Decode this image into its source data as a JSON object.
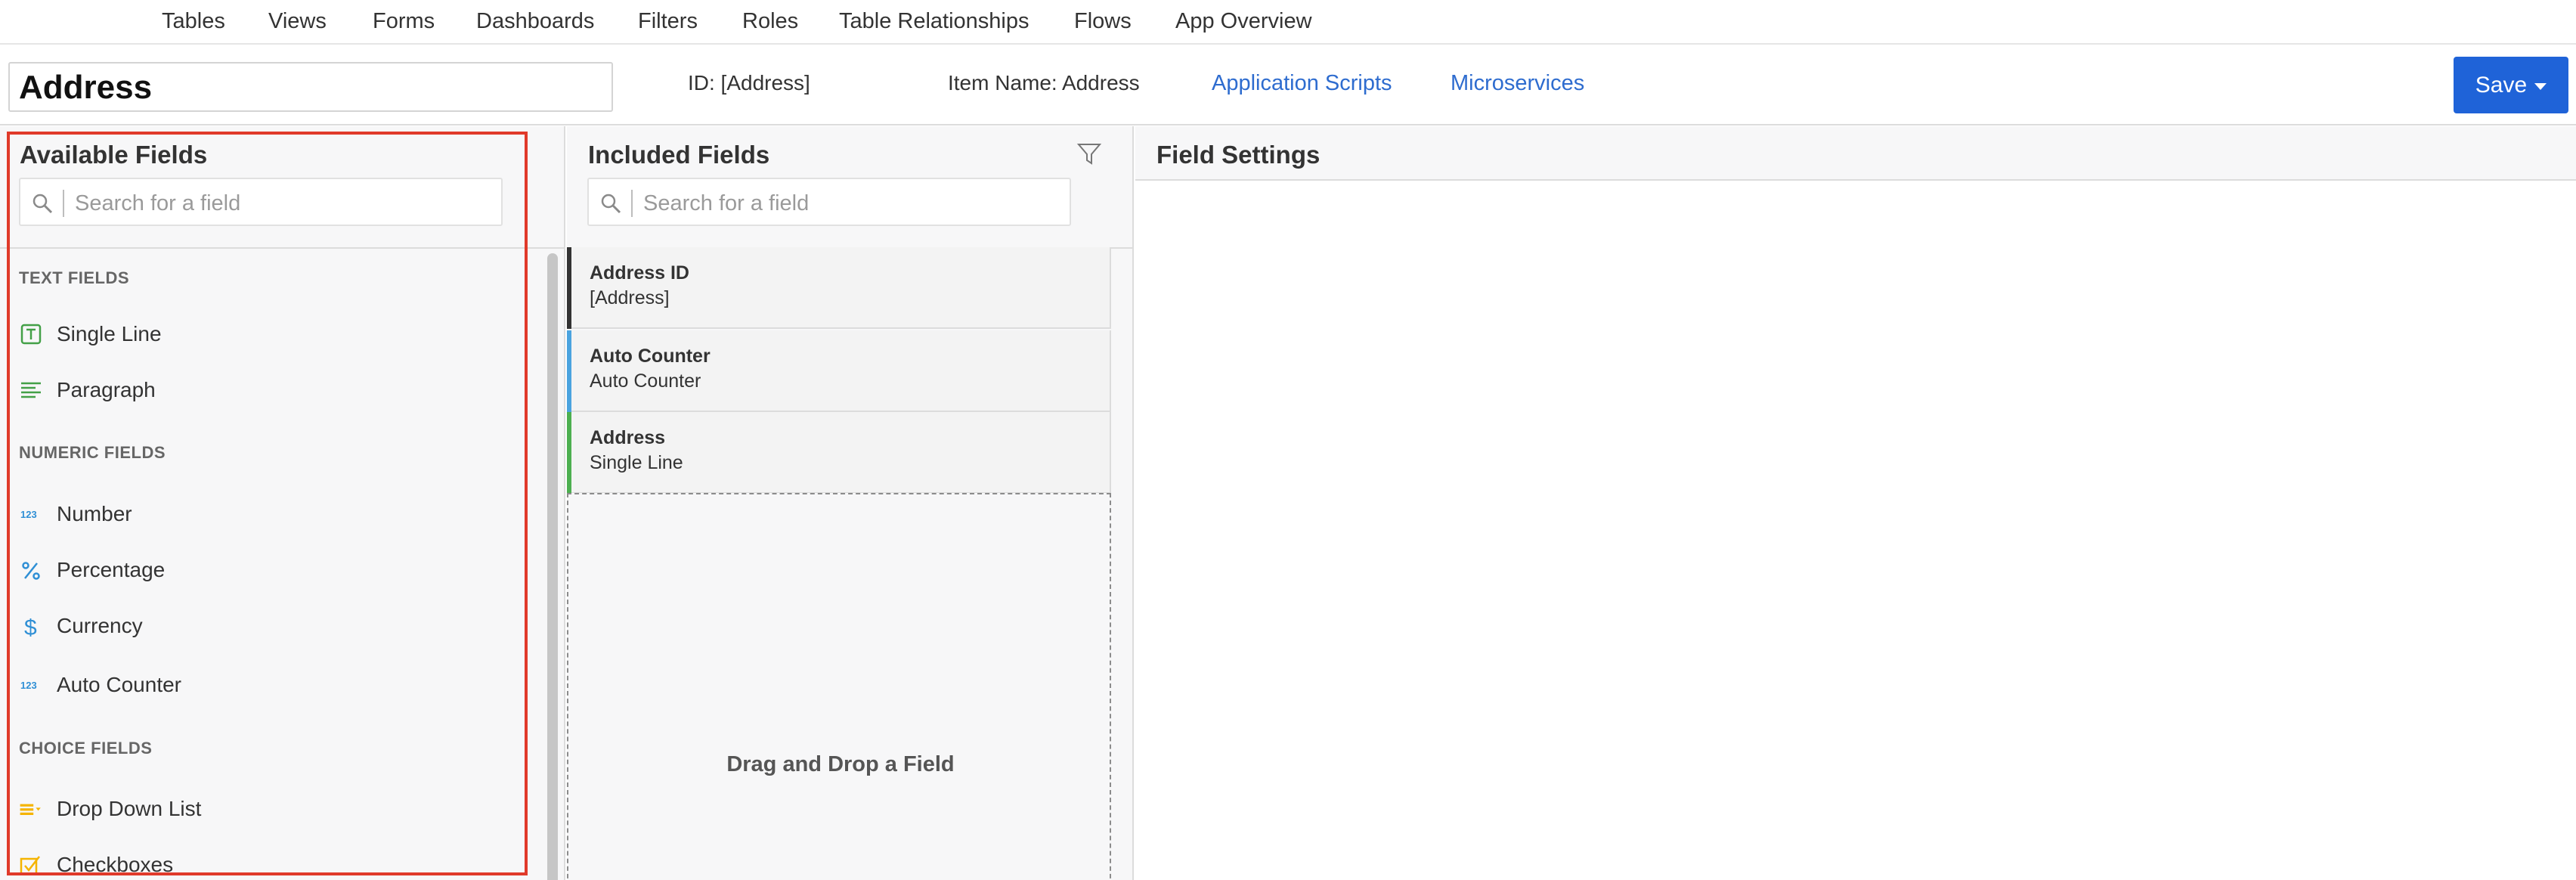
{
  "nav": {
    "items": [
      "Tables",
      "Views",
      "Forms",
      "Dashboards",
      "Filters",
      "Roles",
      "Table Relationships",
      "Flows",
      "App Overview"
    ]
  },
  "header": {
    "title": "Address",
    "id_text": "ID: [Address]",
    "item_name": "Item Name: Address",
    "links": [
      "Application Scripts",
      "Microservices"
    ],
    "save_label": "Save"
  },
  "available": {
    "title": "Available Fields",
    "search_placeholder": "Search for a field",
    "sections": [
      {
        "label": "TEXT FIELDS",
        "fields": [
          {
            "label": "Single Line",
            "icon": "text-t-icon"
          },
          {
            "label": "Paragraph",
            "icon": "paragraph-icon"
          }
        ]
      },
      {
        "label": "NUMERIC FIELDS",
        "fields": [
          {
            "label": "Number",
            "icon": "123-icon"
          },
          {
            "label": "Percentage",
            "icon": "percent-icon"
          },
          {
            "label": "Currency",
            "icon": "dollar-icon"
          },
          {
            "label": "Auto Counter",
            "icon": "123-icon"
          }
        ]
      },
      {
        "label": "CHOICE FIELDS",
        "fields": [
          {
            "label": "Drop Down List",
            "icon": "dropdown-list-icon"
          },
          {
            "label": "Checkboxes",
            "icon": "checkbox-icon"
          }
        ]
      }
    ]
  },
  "included": {
    "title": "Included Fields",
    "search_placeholder": "Search for a field",
    "items": [
      {
        "name": "Address ID",
        "type": "[Address]",
        "color": "#333333"
      },
      {
        "name": "Auto Counter",
        "type": "Auto Counter",
        "color": "#4aa3df"
      },
      {
        "name": "Address",
        "type": "Single Line",
        "color": "#4caf50"
      }
    ],
    "dropzone_text": "Drag and Drop a Field"
  },
  "settings": {
    "title": "Field Settings"
  },
  "colors": {
    "accent": "#1f63d8",
    "link": "#2e6ccf",
    "highlight": "#e03a2a",
    "text_icon": "#43a047",
    "numeric_icon": "#2f8fd5",
    "choice_icon": "#f5b400"
  }
}
